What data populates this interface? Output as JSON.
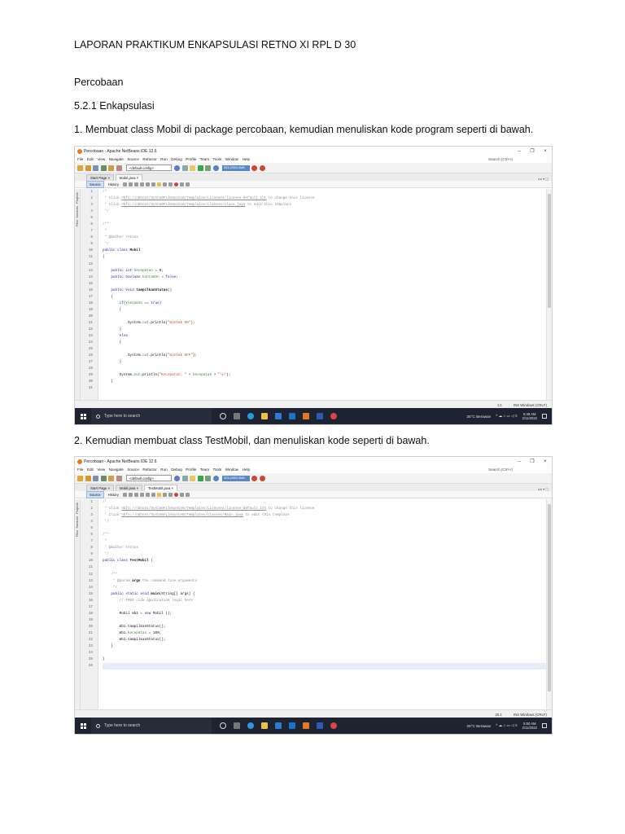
{
  "document": {
    "header": "LAPORAN PRAKTIKUM ENKAPSULASI RETNO XI RPL D 30",
    "section": "Percobaan",
    "subsection": "5.2.1 Enkapsulasi",
    "step1": "1. Membuat class Mobil di package percobaan, kemudian menuliskan kode program seperti di bawah.",
    "step2": "2. Kemudian membuat class TestMobil, dan menuliskan kode seperti di bawah."
  },
  "ide": {
    "window_title": "Percobaan - Apache NetBeans IDE 12.6",
    "minimize": "–",
    "restore": "❐",
    "close": "×",
    "menu": [
      "File",
      "Edit",
      "View",
      "Navigate",
      "Source",
      "Refactor",
      "Run",
      "Debug",
      "Profile",
      "Team",
      "Tools",
      "Window",
      "Help"
    ],
    "search_placeholder": "Search (Ctrl+I)",
    "config_select": "<default config>",
    "memory": "323.2/554.0MB",
    "tab_start_page": "Start Page",
    "tab_close": "×",
    "editor_source": "Source",
    "editor_history": "History",
    "side_panels": [
      "Projects",
      "Services",
      "Files"
    ],
    "tab_controls": "◂ ▸ ▾ ▢"
  },
  "screenshot1": {
    "tab_active": "Mobil.java",
    "status_position": "1:1",
    "status_mode": "INS Windows (CRLF)",
    "code_lines": [
      [
        {
          "t": "/*",
          "c": "cm"
        }
      ],
      [
        {
          "t": " * Click ",
          "c": "cm"
        },
        {
          "t": "nbfs://nbhost/SystemFileSystem/Templates/Licenses/license-default.txt",
          "c": "lnk"
        },
        {
          "t": " to change this license",
          "c": "cm"
        }
      ],
      [
        {
          "t": " * Click ",
          "c": "cm"
        },
        {
          "t": "nbfs://nbhost/SystemFileSystem/Templates/Classes/Class.java",
          "c": "lnk"
        },
        {
          "t": " to edit this template",
          "c": "cm"
        }
      ],
      [
        {
          "t": " */",
          "c": "cm"
        }
      ],
      [
        {
          "t": ""
        }
      ],
      [
        {
          "t": "/**",
          "c": "cm"
        }
      ],
      [
        {
          "t": " *",
          "c": "cm"
        }
      ],
      [
        {
          "t": " * @author retnos",
          "c": "cm"
        }
      ],
      [
        {
          "t": " */",
          "c": "cm"
        }
      ],
      [
        {
          "t": "public class ",
          "c": "kw"
        },
        {
          "t": "Mobil",
          "c": "bold"
        }
      ],
      [
        {
          "t": "{"
        }
      ],
      [
        {
          "t": ""
        }
      ],
      [
        {
          "t": "    "
        },
        {
          "t": "public int ",
          "c": "kw"
        },
        {
          "t": "kecepatan",
          "c": "fld"
        },
        {
          "t": " = 0;"
        }
      ],
      [
        {
          "t": "    "
        },
        {
          "t": "public boolean ",
          "c": "kw"
        },
        {
          "t": "kontakOn",
          "c": "fld"
        },
        {
          "t": " = "
        },
        {
          "t": "false",
          "c": "kw"
        },
        {
          "t": ";"
        }
      ],
      [
        {
          "t": ""
        }
      ],
      [
        {
          "t": "    "
        },
        {
          "t": "public void ",
          "c": "kw"
        },
        {
          "t": "tampilkanStatus",
          "c": "bold"
        },
        {
          "t": "()"
        }
      ],
      [
        {
          "t": "    {"
        }
      ],
      [
        {
          "t": "        "
        },
        {
          "t": "if",
          "c": "kw"
        },
        {
          "t": "("
        },
        {
          "t": "kontakOn",
          "c": "fld"
        },
        {
          "t": " == "
        },
        {
          "t": "true",
          "c": "kw"
        },
        {
          "t": ")"
        }
      ],
      [
        {
          "t": "        {"
        }
      ],
      [
        {
          "t": ""
        }
      ],
      [
        {
          "t": "            System."
        },
        {
          "t": "out",
          "c": "fld"
        },
        {
          "t": ".println("
        },
        {
          "t": "\"Kontak ON\"",
          "c": "str"
        },
        {
          "t": ");"
        }
      ],
      [
        {
          "t": "        }"
        }
      ],
      [
        {
          "t": "        "
        },
        {
          "t": "else",
          "c": "kw"
        }
      ],
      [
        {
          "t": "        {"
        }
      ],
      [
        {
          "t": ""
        }
      ],
      [
        {
          "t": "            System."
        },
        {
          "t": "out",
          "c": "fld"
        },
        {
          "t": ".println("
        },
        {
          "t": "\"Kontak OFF\"",
          "c": "str"
        },
        {
          "t": ");"
        }
      ],
      [
        {
          "t": "        }"
        }
      ],
      [
        {
          "t": ""
        }
      ],
      [
        {
          "t": "        System."
        },
        {
          "t": "out",
          "c": "fld"
        },
        {
          "t": ".println("
        },
        {
          "t": "\"Kecepatan: \"",
          "c": "str"
        },
        {
          "t": " + "
        },
        {
          "t": "kecepatan",
          "c": "fld"
        },
        {
          "t": " + "
        },
        {
          "t": "\"\\n\"",
          "c": "str"
        },
        {
          "t": ");"
        }
      ],
      [
        {
          "t": "    }"
        }
      ],
      [
        {
          "t": ""
        }
      ]
    ],
    "clock_time": "5:48 AM",
    "clock_date": "2/11/2022"
  },
  "screenshot2": {
    "tab_mobil": "Mobil.java",
    "tab_active": "TestMobil.java",
    "status_position": "26:1",
    "status_mode": "INS Windows (CRLF)",
    "highlight_line": 26,
    "code_lines": [
      [
        {
          "t": "/*",
          "c": "cm"
        }
      ],
      [
        {
          "t": " * Click ",
          "c": "cm"
        },
        {
          "t": "nbfs://nbhost/SystemFileSystem/Templates/Licenses/license-default.txt",
          "c": "lnk"
        },
        {
          "t": " to change this license",
          "c": "cm"
        }
      ],
      [
        {
          "t": " * Click ",
          "c": "cm"
        },
        {
          "t": "nbfs://nbhost/SystemFileSystem/Templates/Classes/Main.java",
          "c": "lnk"
        },
        {
          "t": " to edit this template",
          "c": "cm"
        }
      ],
      [
        {
          "t": " */",
          "c": "cm"
        }
      ],
      [
        {
          "t": ""
        }
      ],
      [
        {
          "t": "/**",
          "c": "cm"
        }
      ],
      [
        {
          "t": " *",
          "c": "cm"
        }
      ],
      [
        {
          "t": " * @author retnos",
          "c": "cm"
        }
      ],
      [
        {
          "t": " */",
          "c": "cm"
        }
      ],
      [
        {
          "t": "public class ",
          "c": "kw"
        },
        {
          "t": "TestMobil",
          "c": "bold"
        },
        {
          "t": " {"
        }
      ],
      [
        {
          "t": ""
        }
      ],
      [
        {
          "t": "    /**",
          "c": "cm"
        }
      ],
      [
        {
          "t": "     * @param ",
          "c": "cm"
        },
        {
          "t": "args",
          "c": "bold"
        },
        {
          "t": " the command line arguments",
          "c": "cm"
        }
      ],
      [
        {
          "t": "     */",
          "c": "cm"
        }
      ],
      [
        {
          "t": "    "
        },
        {
          "t": "public static void ",
          "c": "kw"
        },
        {
          "t": "main",
          "c": "bold"
        },
        {
          "t": "(String[] args) {"
        }
      ],
      [
        {
          "t": "        // TODO code application logic here",
          "c": "cm"
        }
      ],
      [
        {
          "t": ""
        }
      ],
      [
        {
          "t": "        Mobil mb1 = "
        },
        {
          "t": "new ",
          "c": "kw"
        },
        {
          "t": "Mobil ();"
        }
      ],
      [
        {
          "t": ""
        }
      ],
      [
        {
          "t": "        mb1.tampilkanStatus();"
        }
      ],
      [
        {
          "t": "        mb1."
        },
        {
          "t": "kecepatan",
          "c": "fld"
        },
        {
          "t": " = 100;"
        }
      ],
      [
        {
          "t": "        mb1.tampilkanStatus();"
        }
      ],
      [
        {
          "t": "    }"
        }
      ],
      [
        {
          "t": ""
        }
      ],
      [
        {
          "t": "}"
        }
      ],
      [
        {
          "t": ""
        }
      ]
    ],
    "clock_time": "5:50 AM",
    "clock_date": "2/11/2022"
  },
  "taskbar": {
    "search_placeholder": "Type here to search",
    "weather": "25°C Berawan",
    "tray_icons": "^ ☁ ⌂ ▭ ◁ ≡"
  }
}
